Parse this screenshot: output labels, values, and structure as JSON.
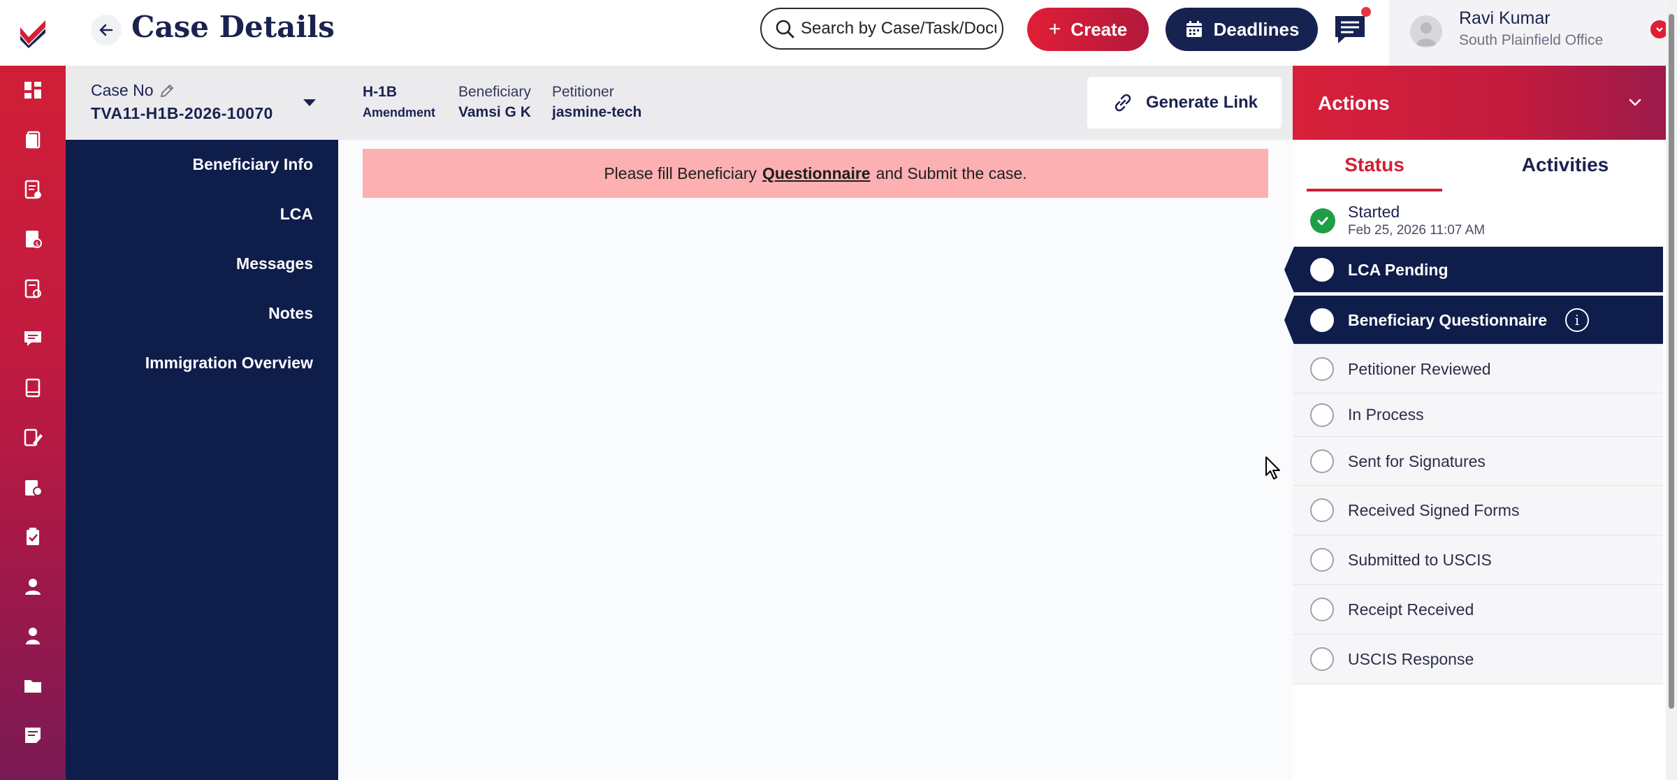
{
  "header": {
    "title": "Case Details",
    "search_placeholder": "Search by Case/Task/Document",
    "create_label": "Create",
    "deadlines_label": "Deadlines",
    "user_name": "Ravi Kumar",
    "user_office": "South Plainfield Office"
  },
  "rail": {
    "icons": [
      "dashboard-icon",
      "cases-icon",
      "documents-icon",
      "billing-icon",
      "checklist-icon",
      "messages-icon",
      "forms-icon",
      "edit-forms-icon",
      "reports-icon",
      "clipboard-icon",
      "user-icon",
      "users-icon",
      "folder-icon",
      "notes-icon"
    ]
  },
  "case": {
    "case_no_label": "Case No",
    "case_no": "TVA11-H1B-2026-10070",
    "visa_type": "H-1B",
    "visa_subtype": "Amendment",
    "beneficiary_label": "Beneficiary",
    "beneficiary": "Vamsi G K",
    "petitioner_label": "Petitioner",
    "petitioner": "jasmine-tech",
    "generate_link_label": "Generate Link"
  },
  "case_nav": {
    "items": [
      "Beneficiary Info",
      "LCA",
      "Messages",
      "Notes",
      "Immigration Overview"
    ]
  },
  "alert": {
    "prefix": "Please fill Beneficiary",
    "link": "Questionnaire",
    "suffix": "and Submit the case."
  },
  "actions": {
    "title": "Actions",
    "tabs": [
      "Status",
      "Activities"
    ],
    "started": {
      "label": "Started",
      "date": "Feb 25, 2026 11:07 AM"
    },
    "steps": [
      "LCA Pending",
      "Beneficiary Questionnaire",
      "Petitioner Reviewed",
      "In Process",
      "Sent for Signatures",
      "Received Signed Forms",
      "Submitted to USCIS",
      "Receipt Received",
      "USCIS Response"
    ]
  },
  "colors": {
    "brand_red": "#d31f35",
    "navy": "#0f1d4b",
    "alert_bg": "#fdb0b1",
    "success": "#1f9e47"
  }
}
